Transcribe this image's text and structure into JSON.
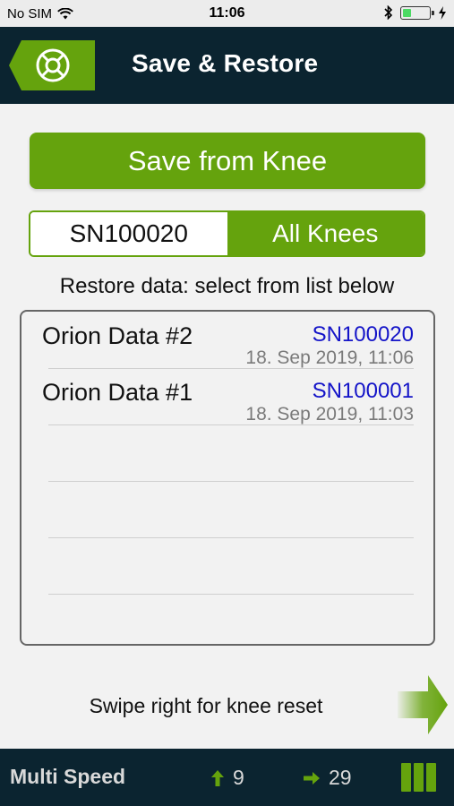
{
  "status": {
    "carrier": "No SIM",
    "time": "11:06"
  },
  "nav": {
    "title": "Save & Restore",
    "back_icon": "lifebuoy-icon"
  },
  "save_button_label": "Save from Knee",
  "segment": {
    "left": "SN100020",
    "right": "All Knees",
    "selected": "All Knees"
  },
  "restore_label": "Restore data: select from list below",
  "list": [
    {
      "name": "Orion Data #2",
      "serial": "SN100020",
      "date": "18. Sep 2019, 11:06"
    },
    {
      "name": "Orion Data #1",
      "serial": "SN100001",
      "date": "18. Sep 2019, 11:03"
    }
  ],
  "swipe_text": "Swipe right for knee reset",
  "footer": {
    "mode": "Multi Speed",
    "up_value": "9",
    "right_value": "29"
  },
  "colors": {
    "accent": "#65a30d",
    "navbar": "#0b2430",
    "serial_text": "#1414c8"
  }
}
